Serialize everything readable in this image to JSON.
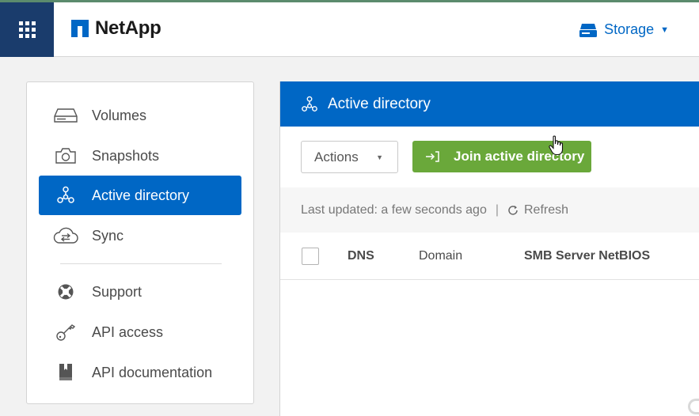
{
  "header": {
    "brand": "NetApp",
    "storage_label": "Storage",
    "apps_icon": "apps-grid-icon",
    "storage_icon": "storage-drive-icon"
  },
  "sidebar": {
    "items": [
      {
        "label": "Volumes",
        "icon": "volume-icon",
        "active": false
      },
      {
        "label": "Snapshots",
        "icon": "camera-icon",
        "active": false
      },
      {
        "label": "Active directory",
        "icon": "network-tree-icon",
        "active": true
      },
      {
        "label": "Sync",
        "icon": "cloud-sync-icon",
        "active": false
      },
      {
        "label": "Support",
        "icon": "lifebuoy-icon",
        "active": false
      },
      {
        "label": "API access",
        "icon": "key-icon",
        "active": false
      },
      {
        "label": "API documentation",
        "icon": "book-icon",
        "active": false
      }
    ]
  },
  "panel": {
    "title": "Active directory",
    "actions_label": "Actions",
    "join_label": "Join active directory",
    "status": {
      "last_updated": "Last updated: a few seconds ago",
      "separator": "|",
      "refresh_label": "Refresh"
    },
    "columns": [
      "DNS",
      "Domain",
      "SMB Server NetBIOS"
    ]
  },
  "colors": {
    "brand_blue": "#0067c5",
    "nav_dark": "#1a3c6c",
    "join_green": "#6aa83a"
  }
}
